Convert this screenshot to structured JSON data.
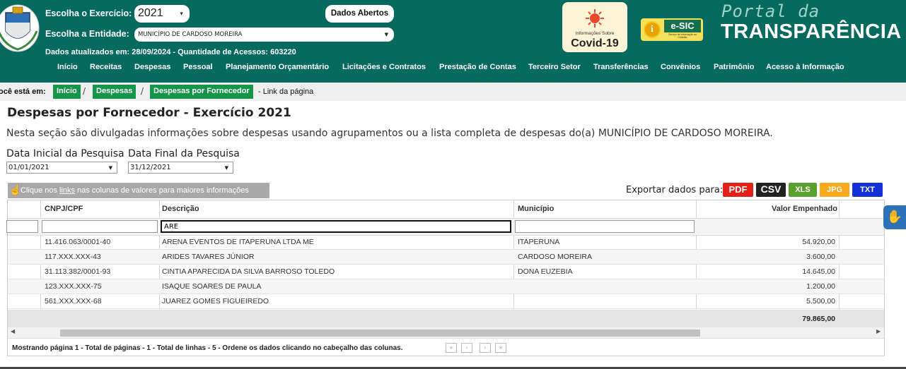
{
  "header": {
    "year_label": "Escolha o Exercício:",
    "year_value": "2021",
    "entity_label": "Escolha a Entidade:",
    "entity_value": "MUNICÍPIO DE CARDOSO MOREIRA",
    "dados_abertos": "Dados Abertos",
    "status": "Dados atualizados em: 28/09/2024 - Quantidade de Acessos: 603220",
    "covid_small": "Informações Sobre",
    "covid_big": "Covid-19",
    "esic_label": "e-SIC",
    "esic_sub": "Serviço de Informação ao Cidadão",
    "portal_small": "Portal da",
    "portal_big": "TRANSPARÊNCIA"
  },
  "nav": [
    "Início",
    "Receitas",
    "Despesas",
    "Pessoal",
    "Planejamento Orçamentário",
    "Licitações e Contratos",
    "Prestação de Contas",
    "Terceiro Setor",
    "Transferências",
    "Convênios",
    "Patrimônio",
    "Acesso à Informação"
  ],
  "breadcrumb": {
    "label": "ocê está em:",
    "items": [
      "Início",
      "Despesas",
      "Despesas por Fornecedor"
    ],
    "tail": "- Link da página"
  },
  "page": {
    "title": "Despesas por Fornecedor - Exercício 2021",
    "description": "Nesta seção são divulgadas informações sobre despesas usando agrupamentos ou a lista completa de despesas do(a) MUNICÍPIO DE CARDOSO MOREIRA.",
    "start_label": "Data Inicial da Pesquisa",
    "start_value": "01/01/2021",
    "end_label": "Data Final da Pesquisa",
    "end_value": "31/12/2021"
  },
  "toolbar": {
    "hint_before": "Clique nos ",
    "hint_link": "links",
    "hint_after": " nas colunas de valores para maiores informações",
    "export_label": "Exportar dados para:",
    "exports": [
      {
        "label": "PDF",
        "color": "#e32119"
      },
      {
        "label": "CSV",
        "color": "#222222"
      },
      {
        "label": "XLS",
        "color": "#5aa02c"
      },
      {
        "label": "JPG",
        "color": "#f7a81b"
      },
      {
        "label": "TXT",
        "color": "#1630d8"
      }
    ]
  },
  "table": {
    "headers": [
      "CNPJ/CPF",
      "Descrição",
      "Município",
      "Valor Empenhado"
    ],
    "filter_descricao": "ARE",
    "rows": [
      {
        "cnpj": "11.416.063/0001-40",
        "descricao": "ARENA EVENTOS DE ITAPERUNA LTDA ME",
        "municipio": "ITAPERUNA",
        "valor": "54.920,00"
      },
      {
        "cnpj": "117.XXX.XXX-43",
        "descricao": "ARIDES TAVARES JÚNIOR",
        "municipio": "CARDOSO MOREIRA",
        "valor": "3.600,00"
      },
      {
        "cnpj": "31.113.382/0001-93",
        "descricao": "CINTIA APARECIDA DA SILVA BARROSO TOLEDO",
        "municipio": "DONA EUZEBIA",
        "valor": "14.645,00"
      },
      {
        "cnpj": "123.XXX.XXX-75",
        "descricao": "ISAQUE SOARES DE PAULA",
        "municipio": "",
        "valor": "1.200,00"
      },
      {
        "cnpj": "561.XXX.XXX-68",
        "descricao": "JUAREZ GOMES FIGUEIREDO",
        "municipio": "",
        "valor": "5.500,00"
      }
    ],
    "total": "79.865,00",
    "pager_text": "Mostrando página 1 - Total de páginas - 1 - Total de linhas - 5 - Ordene os dados clicando no cabeçalho das colunas.",
    "pager_buttons": [
      "«",
      "‹",
      "›",
      "»"
    ]
  },
  "icons": {
    "hand": "hand-pointer-icon",
    "accessibility": "sign-language-icon"
  }
}
